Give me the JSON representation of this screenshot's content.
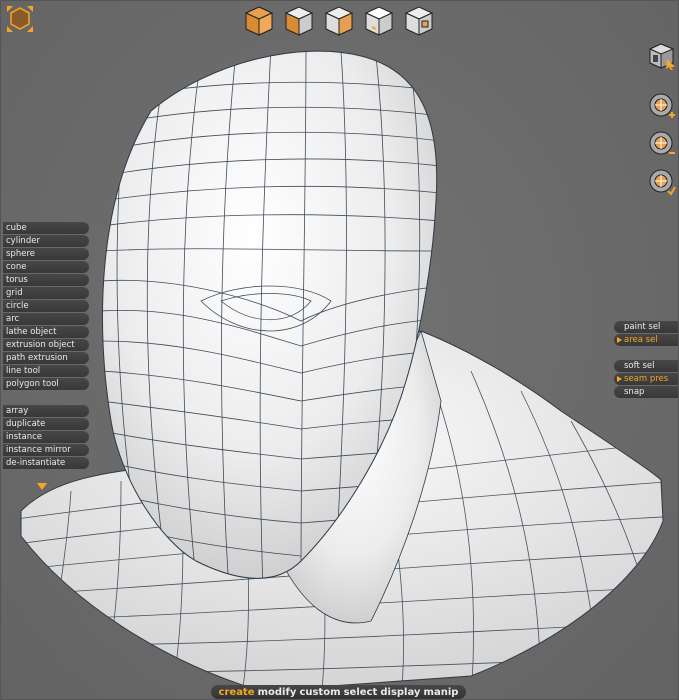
{
  "view_cubes": [
    {
      "name": "perspective-view-cube-icon"
    },
    {
      "name": "front-view-cube-icon"
    },
    {
      "name": "side-view-cube-icon"
    },
    {
      "name": "top-view-cube-icon"
    },
    {
      "name": "back-view-cube-icon"
    }
  ],
  "right_icons": [
    {
      "name": "camera-view-icon"
    },
    {
      "name": "zoom-in-icon"
    },
    {
      "name": "zoom-out-icon"
    },
    {
      "name": "zoom-fit-icon"
    }
  ],
  "create_menu": {
    "items": [
      "cube",
      "cylinder",
      "sphere",
      "cone",
      "torus",
      "grid",
      "circle",
      "arc",
      "lathe object",
      "extrusion object",
      "path extrusion",
      "line tool",
      "polygon tool"
    ]
  },
  "instance_menu": {
    "items": [
      "array",
      "duplicate",
      "instance",
      "instance mirror",
      "de-instantiate"
    ]
  },
  "selection_menu": {
    "items": [
      {
        "label": "paint sel",
        "active": false
      },
      {
        "label": "area sel",
        "active": true
      }
    ]
  },
  "options_menu": {
    "items": [
      {
        "label": "soft sel",
        "active": false
      },
      {
        "label": "seam pres",
        "active": true
      },
      {
        "label": "snap",
        "active": false
      }
    ]
  },
  "bottom_tabs": {
    "items": [
      {
        "label": "create",
        "active": true
      },
      {
        "label": "modify",
        "active": false
      },
      {
        "label": "custom",
        "active": false
      },
      {
        "label": "select",
        "active": false
      },
      {
        "label": "display",
        "active": false
      },
      {
        "label": "manip",
        "active": false
      }
    ]
  },
  "colors": {
    "accent": "#f5a623",
    "background": "#6c6c6c",
    "menu_bg": "#3c3c3c",
    "mesh_fill": "#f2f2f2",
    "mesh_wire": "#2a3a4a"
  }
}
